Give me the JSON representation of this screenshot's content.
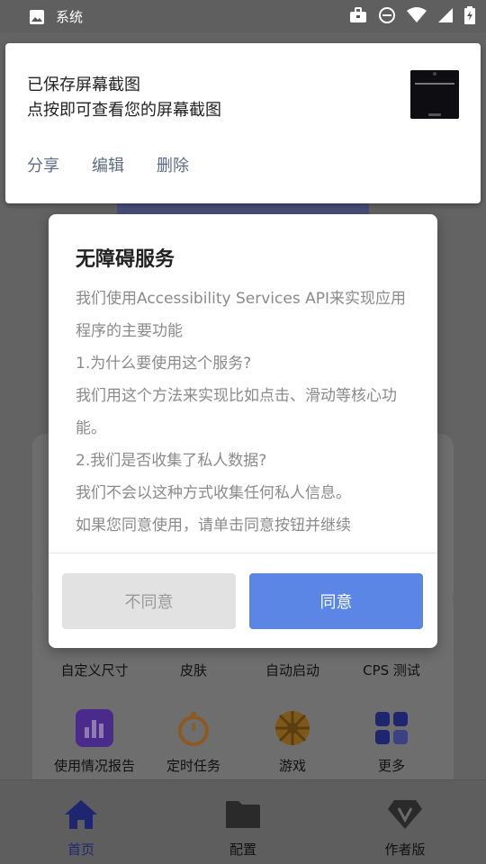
{
  "status_bar": {
    "app_label": "系统",
    "icons": [
      "gallery-icon",
      "briefcase-icon",
      "dnd-icon",
      "wifi-icon",
      "signal-icon",
      "battery-icon"
    ]
  },
  "background": {
    "grid_row1": [
      "自定义尺寸",
      "皮肤",
      "自动启动",
      "CPS 测试"
    ],
    "grid_row2": [
      "使用情况报告",
      "定时任务",
      "游戏",
      "更多"
    ],
    "nav": [
      "首页",
      "配置",
      "作者版"
    ],
    "accent": "#2f3ab0",
    "orange": "#c9781e"
  },
  "notification": {
    "title": "已保存屏幕截图",
    "subtitle": "点按即可查看您的屏幕截图",
    "actions": [
      "分享",
      "编辑",
      "删除"
    ],
    "action_color": "#5c6b86"
  },
  "dialog": {
    "title": "无障碍服务",
    "body": [
      "我们使用Accessibility Services API来实现应用程序的主要功能",
      "1.为什么要使用这个服务?",
      "我们用这个方法来实现比如点击、滑动等核心功能。",
      "2.我们是否收集了私人数据?",
      "我们不会以这种方式收集任何私人信息。",
      "如果您同意使用，请单击同意按钮并继续"
    ],
    "disagree_label": "不同意",
    "agree_label": "同意",
    "agree_color": "#5b86e5"
  }
}
